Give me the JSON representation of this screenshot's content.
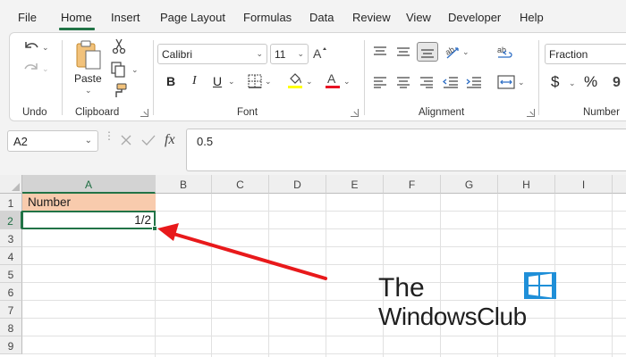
{
  "menu": {
    "items": [
      {
        "id": "file",
        "label": "File"
      },
      {
        "id": "home",
        "label": "Home"
      },
      {
        "id": "insert",
        "label": "Insert"
      },
      {
        "id": "page-layout",
        "label": "Page Layout"
      },
      {
        "id": "formulas",
        "label": "Formulas"
      },
      {
        "id": "data",
        "label": "Data"
      },
      {
        "id": "review",
        "label": "Review"
      },
      {
        "id": "view",
        "label": "View"
      },
      {
        "id": "developer",
        "label": "Developer"
      },
      {
        "id": "help",
        "label": "Help"
      }
    ],
    "active": "Home"
  },
  "ribbon": {
    "undo_group_label": "Undo",
    "clipboard_group_label": "Clipboard",
    "paste_label": "Paste",
    "font_group_label": "Font",
    "font_name": "Calibri",
    "font_size": "11",
    "bold": "B",
    "italic": "I",
    "underline": "U",
    "alignment_group_label": "Alignment",
    "number_group_label": "Number",
    "number_format": "Fraction",
    "currency_symbol": "$",
    "percent_symbol": "%",
    "font_color": "#e81123",
    "highlight_color": "#ffff00"
  },
  "formula_bar": {
    "name_box": "A2",
    "fx": "fx",
    "value": "0.5"
  },
  "sheet": {
    "columns": [
      "A",
      "B",
      "C",
      "D",
      "E",
      "F",
      "G",
      "H",
      "I"
    ],
    "rows": [
      "1",
      "2",
      "3",
      "4",
      "5",
      "6",
      "7",
      "8",
      "9"
    ],
    "selected_cell": "A2",
    "cells": {
      "A1": "Number",
      "A2": "1/2"
    },
    "header_fill": "#f8cbad",
    "accent": "#217346"
  },
  "watermark": {
    "line1": "The",
    "line2": "WindowsClub"
  },
  "annotation": {
    "arrow_color": "#e8191b"
  }
}
